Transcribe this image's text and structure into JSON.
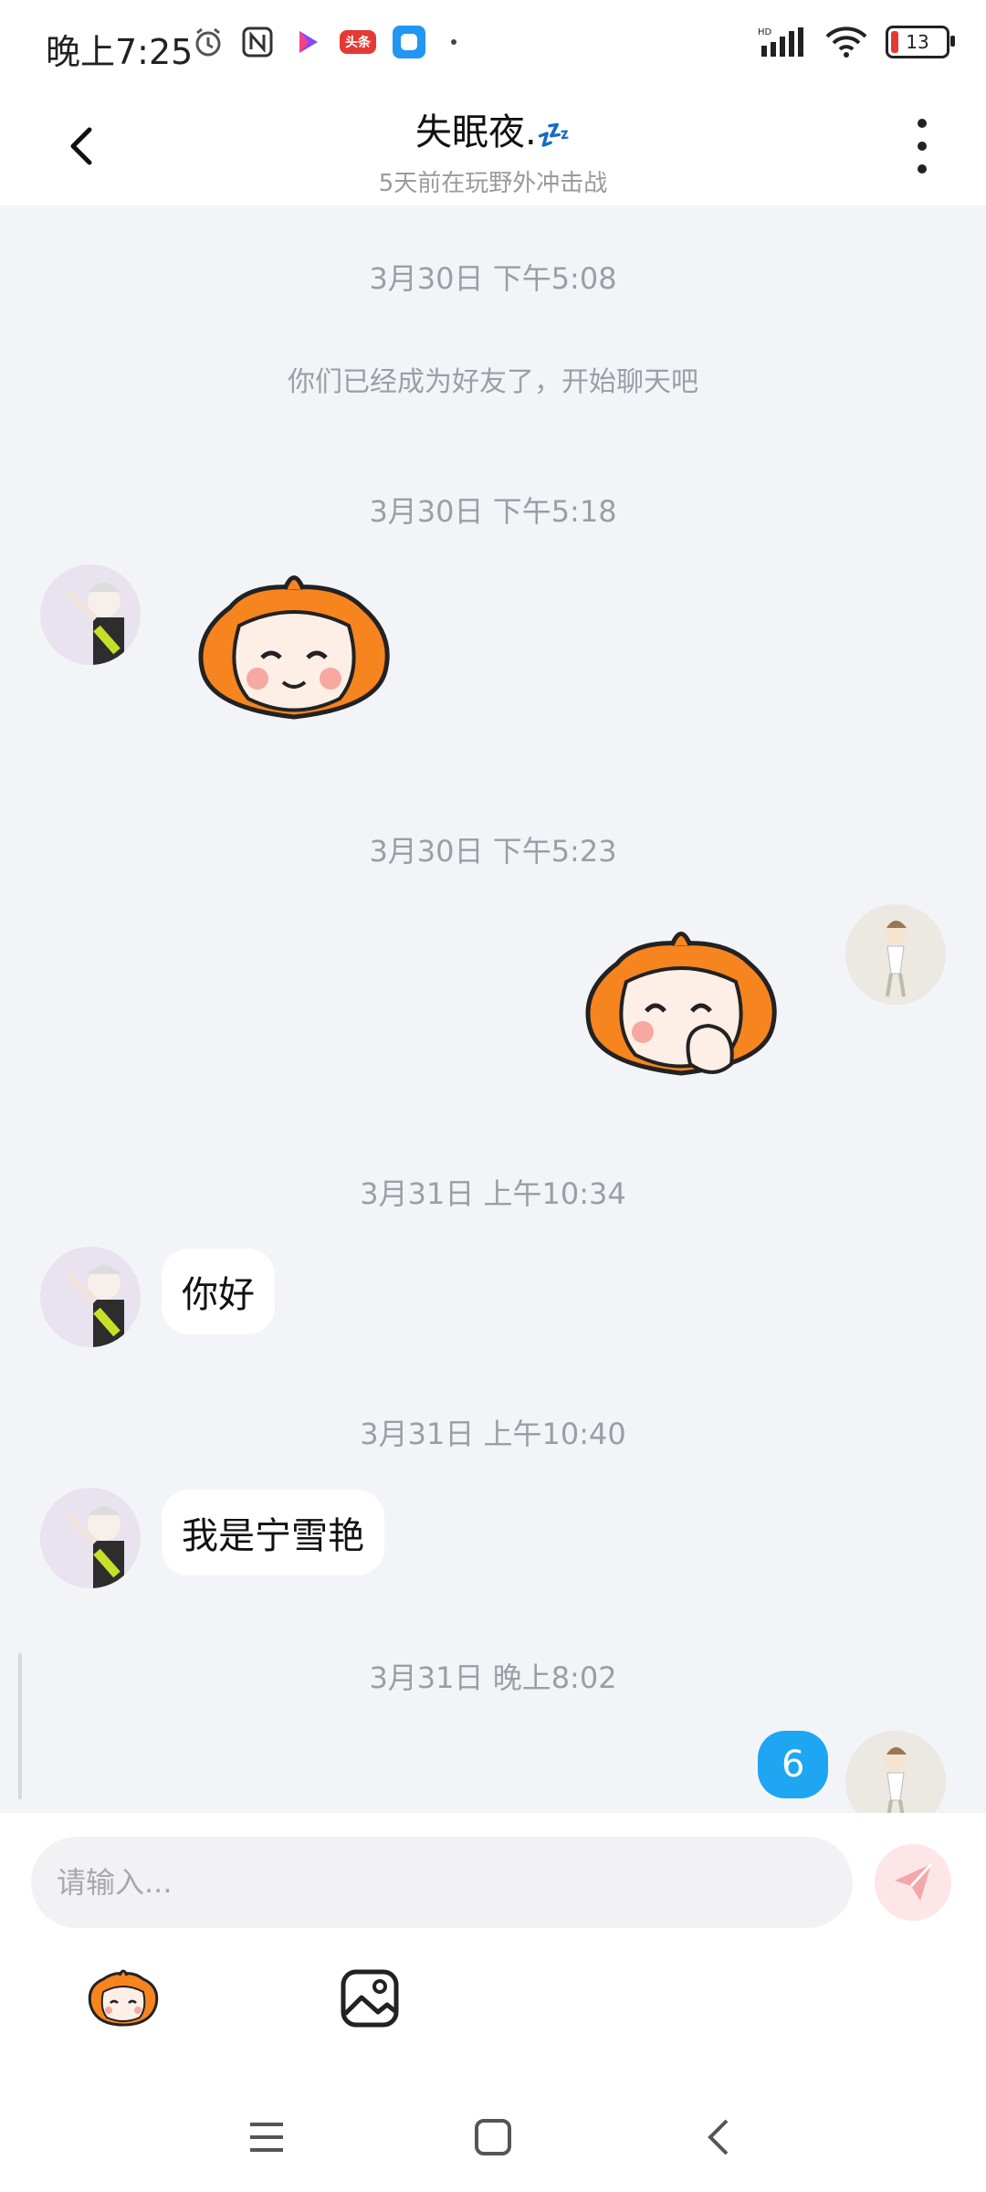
{
  "status_bar": {
    "time": "晚上7:25",
    "battery": "13",
    "app_badge_text": "头条"
  },
  "header": {
    "title": "失眠夜.",
    "title_emoji": "💤",
    "subtitle": "5天前在玩野外冲击战"
  },
  "messages": [
    {
      "kind": "time",
      "text": "3月30日 下午5:08"
    },
    {
      "kind": "system",
      "text": "你们已经成为好友了，开始聊天吧"
    },
    {
      "kind": "time",
      "text": "3月30日 下午5:18"
    },
    {
      "kind": "sticker",
      "side": "left",
      "name": "orange-girl-smile-sticker"
    },
    {
      "kind": "time",
      "text": "3月30日 下午5:23"
    },
    {
      "kind": "sticker",
      "side": "right",
      "name": "orange-girl-laugh-sticker"
    },
    {
      "kind": "time",
      "text": "3月31日 上午10:34"
    },
    {
      "kind": "text",
      "side": "left",
      "text": "你好"
    },
    {
      "kind": "time",
      "text": "3月31日 上午10:40"
    },
    {
      "kind": "text",
      "side": "left",
      "text": "我是宁雪艳"
    },
    {
      "kind": "time",
      "text": "3月31日 晚上8:02"
    },
    {
      "kind": "text",
      "side": "right",
      "text": "6"
    }
  ],
  "input": {
    "placeholder": "请输入..."
  },
  "colors": {
    "accent_blue": "#1ea6f2",
    "chat_bg": "#f3f4f8",
    "send_button_bg": "#fde6e7",
    "send_icon": "#f4a6a9"
  },
  "icons": [
    "back-arrow-icon",
    "more-vertical-icon",
    "send-icon",
    "sticker-icon",
    "image-icon",
    "menu-icon",
    "home-icon",
    "back-nav-icon"
  ]
}
